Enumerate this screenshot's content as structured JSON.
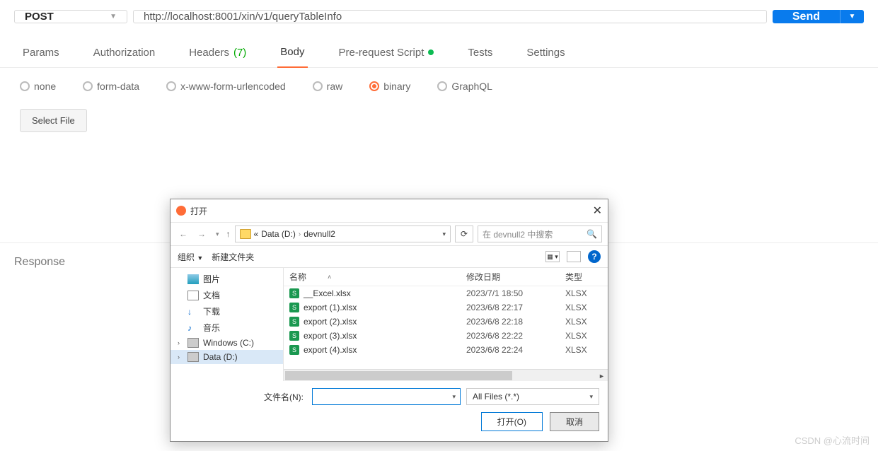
{
  "request": {
    "method": "POST",
    "url": "http://localhost:8001/xin/v1/queryTableInfo",
    "send_label": "Send"
  },
  "tabs": {
    "params": "Params",
    "auth": "Authorization",
    "headers": "Headers",
    "headers_count": "(7)",
    "body": "Body",
    "prerequest": "Pre-request Script",
    "tests": "Tests",
    "settings": "Settings"
  },
  "body_types": {
    "none": "none",
    "formdata": "form-data",
    "urlencoded": "x-www-form-urlencoded",
    "raw": "raw",
    "binary": "binary",
    "graphql": "GraphQL"
  },
  "select_file": "Select File",
  "response": "Response",
  "watermark": "CSDN @心流时间",
  "dialog": {
    "title": "打开",
    "breadcrumb": {
      "prefix": "«",
      "p1": "Data (D:)",
      "p2": "devnull2"
    },
    "search_placeholder": "在 devnull2 中搜索",
    "toolbar": {
      "organize": "组织",
      "newfolder": "新建文件夹"
    },
    "tree": [
      {
        "label": "图片",
        "type": "pic"
      },
      {
        "label": "文档",
        "type": "doc"
      },
      {
        "label": "下载",
        "type": "dl"
      },
      {
        "label": "音乐",
        "type": "music"
      },
      {
        "label": "Windows (C:)",
        "type": "drive",
        "caret": true
      },
      {
        "label": "Data (D:)",
        "type": "drive",
        "caret": true,
        "selected": true
      }
    ],
    "columns": {
      "name": "名称",
      "date": "修改日期",
      "type": "类型"
    },
    "files": [
      {
        "name": "__Excel.xlsx",
        "date": "2023/7/1 18:50",
        "type": "XLSX"
      },
      {
        "name": "export (1).xlsx",
        "date": "2023/6/8 22:17",
        "type": "XLSX"
      },
      {
        "name": "export (2).xlsx",
        "date": "2023/6/8 22:18",
        "type": "XLSX"
      },
      {
        "name": "export (3).xlsx",
        "date": "2023/6/8 22:22",
        "type": "XLSX"
      },
      {
        "name": "export (4).xlsx",
        "date": "2023/6/8 22:24",
        "type": "XLSX"
      }
    ],
    "filename_label": "文件名(N):",
    "filter": "All Files (*.*)",
    "open_btn": "打开(O)",
    "cancel_btn": "取消"
  }
}
